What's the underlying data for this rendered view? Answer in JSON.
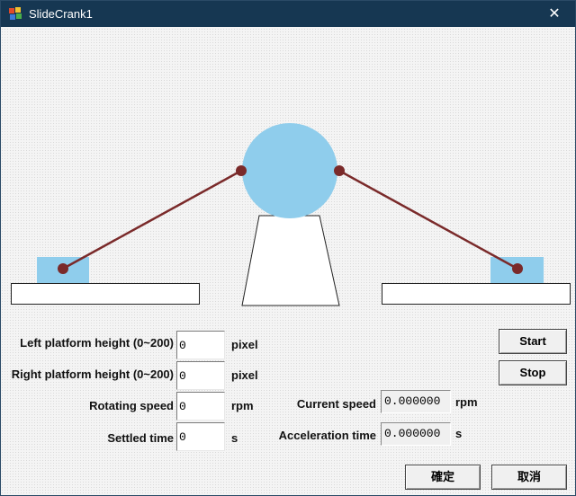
{
  "window": {
    "title": "SlideCrank1",
    "close_glyph": "✕",
    "titlebar_color": "#163752"
  },
  "scene": {
    "platform_fill": "#ffffff",
    "slider_color": "#8fcdec",
    "crank_disc_color": "#8fcdec",
    "rod_color": "#7a2a2a",
    "joint_color": "#7a2a2a"
  },
  "form": {
    "left_platform": {
      "label": "Left platform height (0~200)",
      "value": "0",
      "unit": "pixel"
    },
    "right_platform": {
      "label": "Right platform height (0~200)",
      "value": "0",
      "unit": "pixel"
    },
    "rotating_speed": {
      "label": "Rotating speed",
      "value": "0",
      "unit": "rpm"
    },
    "settled_time": {
      "label": "Settled time",
      "value": "0",
      "unit": "s"
    },
    "current_speed": {
      "label": "Current speed",
      "value": "0.000000",
      "unit": "rpm"
    },
    "acceleration_time": {
      "label": "Acceleration time",
      "value": "0.000000",
      "unit": "s"
    }
  },
  "buttons": {
    "start": "Start",
    "stop": "Stop",
    "ok": "確定",
    "cancel": "取消"
  },
  "icons": {
    "app": "app-icon",
    "close": "close-icon"
  }
}
